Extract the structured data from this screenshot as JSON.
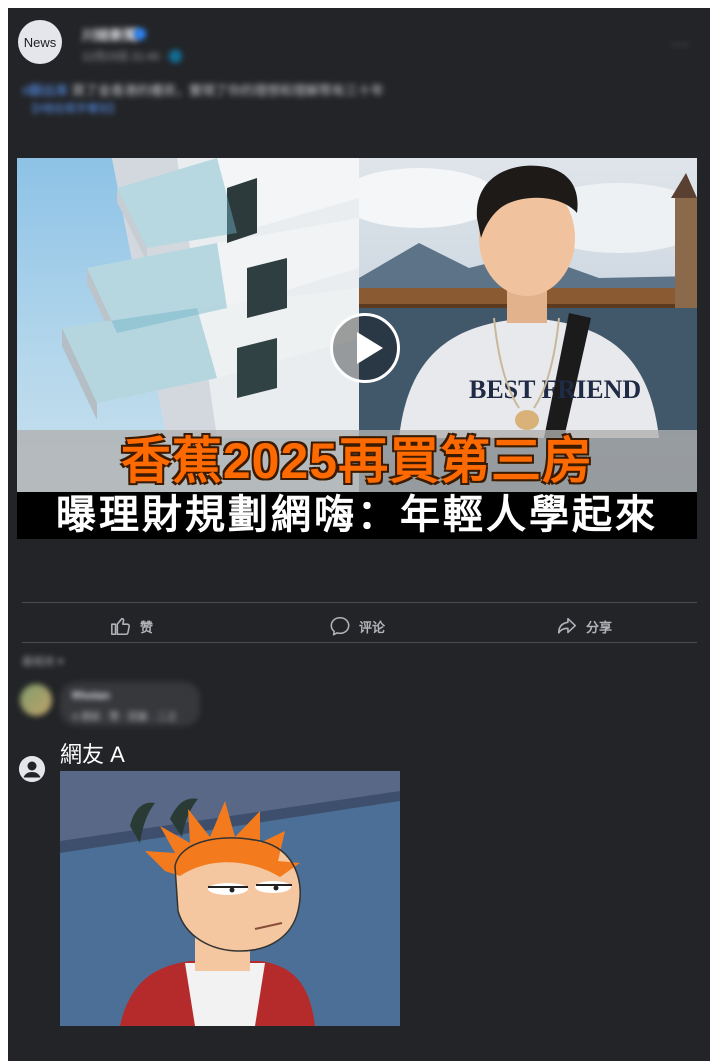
{
  "post": {
    "avatar_text": "News",
    "page_name": "川娃新聞",
    "meta": "12月23日 21:43 · 🌐",
    "more_label": "···",
    "caption_tag": "#翻出來",
    "caption_text": "買了金香港的樓房，實現了你的理想和理解幣有三十年",
    "caption_link": "【#他在呢手哪兒】"
  },
  "thumbnail": {
    "title_line1": "香蕉2025再買第三房",
    "title_line2": "曝理財規劃網嗨：年輕人學起來"
  },
  "actions": {
    "like": "赞",
    "comment": "评论",
    "share": "分享"
  },
  "comments": {
    "sort_label": "最相关 ▾",
    "blurred_author": "Rhotan",
    "blurred_text": "4 週前 · 赞 · 回复 · 二之",
    "user_name": "網友 A"
  },
  "colors": {
    "card_bg": "#232427",
    "accent_orange": "#ff6a00",
    "link_blue": "#5b9cff"
  }
}
